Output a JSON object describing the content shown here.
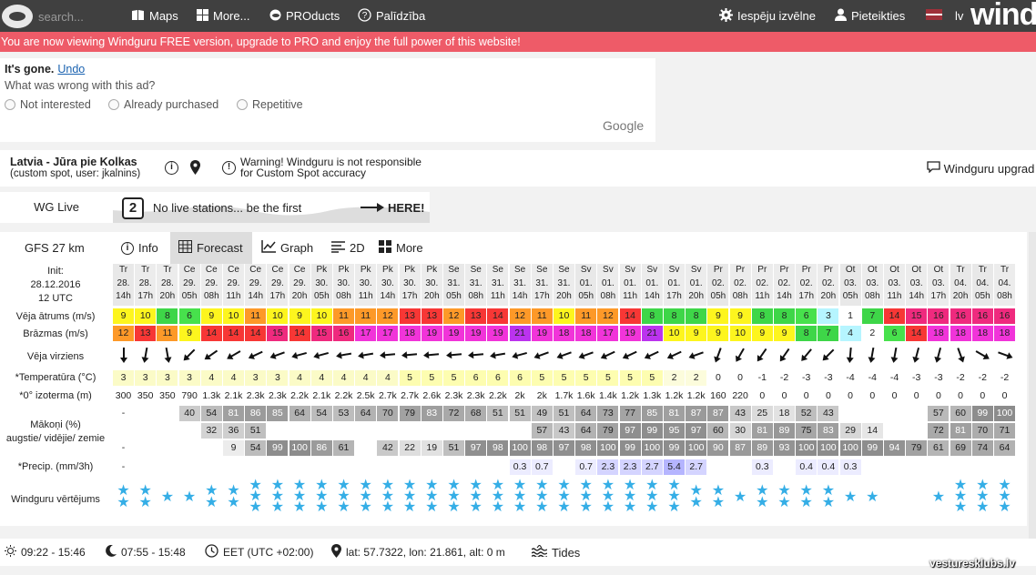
{
  "topbar": {
    "search_placeholder": "search...",
    "maps": "Maps",
    "more": "More...",
    "products": "PROducts",
    "help": "Palīdzība",
    "settings": "Iespēju izvēlne",
    "login": "Pieteikties",
    "lang": "lv",
    "brand": "wind"
  },
  "promo": "You are now viewing Windguru FREE version, upgrade to PRO and enjoy the full power of this website!",
  "ad": {
    "gone": "It's gone.",
    "undo": "Undo",
    "question": "What was wrong with this ad?",
    "opt1": "Not interested",
    "opt2": "Already purchased",
    "opt3": "Repetitive",
    "google": "Google"
  },
  "spot": {
    "name": "Latvia - Jūra pie Kolkas",
    "sub": "(custom spot, user: jkalnins)",
    "warning_line1": "Warning! Windguru is not responsible",
    "warning_line2": "for Custom Spot accuracy",
    "upgrade": "Windguru upgrad"
  },
  "live": {
    "title": "WG Live",
    "badge": "2",
    "text": "No live stations... be the first",
    "here": "HERE!"
  },
  "model": {
    "name": "GFS 27 km",
    "tabs": [
      "Info",
      "Forecast",
      "Graph",
      "2D",
      "More"
    ]
  },
  "labels": {
    "init": "Init:",
    "init_date": "28.12.2016",
    "init_time": "12 UTC",
    "wind": "Vēja ātrums (m/s)",
    "gust": "Brāzmas (m/s)",
    "dir": "Vēja virziens",
    "temp": "*Temperatūra (°C)",
    "iso": "*0° izoterma (m)",
    "cloud1": "Mākoņi (%)",
    "cloud2": "augstie/ vidējie/ zemie",
    "precip": "*Precip. (mm/3h)",
    "rating": "Windguru vērtējums"
  },
  "forecast": {
    "days": [
      "Tr",
      "Tr",
      "Tr",
      "Ce",
      "Ce",
      "Ce",
      "Ce",
      "Ce",
      "Ce",
      "Pk",
      "Pk",
      "Pk",
      "Pk",
      "Pk",
      "Pk",
      "Se",
      "Se",
      "Se",
      "Se",
      "Se",
      "Se",
      "Sv",
      "Sv",
      "Sv",
      "Sv",
      "Sv",
      "Sv",
      "Pr",
      "Pr",
      "Pr",
      "Pr",
      "Pr",
      "Pr",
      "Ot",
      "Ot",
      "Ot",
      "Ot",
      "Ot",
      "Tr",
      "Tr",
      "Tr"
    ],
    "dates": [
      "28.",
      "28.",
      "28.",
      "29.",
      "29.",
      "29.",
      "29.",
      "29.",
      "29.",
      "30.",
      "30.",
      "30.",
      "30.",
      "30.",
      "30.",
      "31.",
      "31.",
      "31.",
      "31.",
      "31.",
      "31.",
      "01.",
      "01.",
      "01.",
      "01.",
      "01.",
      "01.",
      "02.",
      "02.",
      "02.",
      "02.",
      "02.",
      "02.",
      "03.",
      "03.",
      "03.",
      "03.",
      "03.",
      "04.",
      "04.",
      "04."
    ],
    "hours": [
      "14h",
      "17h",
      "20h",
      "05h",
      "08h",
      "11h",
      "14h",
      "17h",
      "20h",
      "05h",
      "08h",
      "11h",
      "14h",
      "17h",
      "20h",
      "05h",
      "08h",
      "11h",
      "14h",
      "17h",
      "20h",
      "05h",
      "08h",
      "11h",
      "14h",
      "17h",
      "20h",
      "05h",
      "08h",
      "11h",
      "14h",
      "17h",
      "20h",
      "05h",
      "08h",
      "11h",
      "14h",
      "17h",
      "20h",
      "05h",
      "08h"
    ],
    "wind": [
      9,
      10,
      8,
      6,
      9,
      10,
      11,
      10,
      9,
      10,
      11,
      11,
      12,
      13,
      13,
      12,
      13,
      14,
      12,
      11,
      10,
      11,
      12,
      14,
      8,
      8,
      8,
      9,
      9,
      8,
      8,
      6,
      3,
      1,
      7,
      14,
      15,
      16,
      16,
      16,
      16
    ],
    "gust": [
      12,
      13,
      11,
      9,
      14,
      14,
      14,
      15,
      14,
      15,
      16,
      17,
      17,
      18,
      19,
      19,
      19,
      19,
      21,
      19,
      18,
      18,
      17,
      19,
      21,
      10,
      9,
      9,
      10,
      9,
      9,
      8,
      7,
      4,
      2,
      6,
      14,
      18,
      18,
      18,
      18
    ],
    "dir_deg": [
      180,
      190,
      170,
      225,
      235,
      240,
      245,
      250,
      255,
      255,
      260,
      260,
      265,
      265,
      265,
      265,
      265,
      260,
      255,
      250,
      250,
      250,
      245,
      245,
      245,
      245,
      250,
      200,
      210,
      215,
      215,
      220,
      225,
      185,
      190,
      190,
      195,
      195,
      160,
      120,
      110
    ],
    "temp": [
      "3",
      "3",
      "3",
      "3",
      "4",
      "4",
      "3",
      "3",
      "4",
      "4",
      "4",
      "4",
      "4",
      "5",
      "5",
      "5",
      "6",
      "6",
      "6",
      "5",
      "5",
      "5",
      "5",
      "5",
      "5",
      "2",
      "2",
      "0",
      "0",
      "-1",
      "-2",
      "-3",
      "-3",
      "-4",
      "-4",
      "-4",
      "-3",
      "-3",
      "-2",
      "-2",
      "-2"
    ],
    "iso": [
      "300",
      "350",
      "350",
      "790",
      "1.3k",
      "2.1k",
      "2.3k",
      "2.3k",
      "2.2k",
      "2.1k",
      "2.2k",
      "2.5k",
      "2.7k",
      "2.7k",
      "2.6k",
      "2.3k",
      "2.3k",
      "2.2k",
      "2k",
      "2k",
      "1.7k",
      "1.6k",
      "1.4k",
      "1.2k",
      "1.3k",
      "1.2k",
      "1.2k",
      "160",
      "220",
      "0",
      "0",
      "0",
      "0",
      "0",
      "0",
      "0",
      "0",
      "0",
      "0",
      "0",
      "0"
    ],
    "cloud_high": [
      "-",
      "",
      "",
      "40",
      "54",
      "81",
      "86",
      "85",
      "64",
      "54",
      "53",
      "64",
      "70",
      "79",
      "83",
      "72",
      "68",
      "51",
      "51",
      "49",
      "51",
      "64",
      "73",
      "77",
      "85",
      "81",
      "87",
      "87",
      "43",
      "25",
      "18",
      "52",
      "43",
      "",
      "",
      "",
      "",
      "57",
      "60",
      "99",
      "100"
    ],
    "cloud_mid": [
      "",
      "",
      "",
      "",
      "32",
      "36",
      "51",
      "",
      "",
      "",
      "",
      "",
      "",
      "",
      "",
      "",
      "",
      "",
      "",
      "57",
      "43",
      "64",
      "79",
      "97",
      "99",
      "95",
      "97",
      "60",
      "30",
      "81",
      "89",
      "75",
      "83",
      "29",
      "14",
      "",
      "",
      "72",
      "81",
      "70",
      "71"
    ],
    "cloud_low": [
      "-",
      "",
      "",
      "",
      "",
      "9",
      "54",
      "99",
      "100",
      "86",
      "61",
      "",
      "42",
      "22",
      "19",
      "51",
      "97",
      "98",
      "100",
      "98",
      "97",
      "98",
      "100",
      "99",
      "100",
      "99",
      "100",
      "90",
      "87",
      "89",
      "93",
      "100",
      "100",
      "100",
      "99",
      "94",
      "79",
      "61",
      "69",
      "74",
      "64"
    ],
    "precip": [
      "-",
      "",
      "",
      "",
      "",
      "",
      "",
      "",
      "",
      "",
      "",
      "",
      "",
      "",
      "",
      "",
      "",
      "",
      "0.3",
      "0.7",
      "",
      "0.7",
      "2.3",
      "2.3",
      "2.7",
      "5.4",
      "2.7",
      "",
      "",
      "0.3",
      "",
      "0.4",
      "0.4",
      "0.3",
      "",
      "",
      "",
      "",
      "",
      "",
      ""
    ],
    "stars": [
      2,
      2,
      1,
      1,
      2,
      2,
      3,
      3,
      3,
      3,
      3,
      3,
      3,
      3,
      3,
      3,
      3,
      3,
      3,
      3,
      3,
      3,
      3,
      3,
      3,
      3,
      2,
      2,
      1,
      2,
      2,
      2,
      2,
      1,
      1,
      0,
      0,
      1,
      3,
      3,
      3
    ]
  },
  "bottom": {
    "sun": "09:22 - 15:46",
    "moon": "07:55 - 15:48",
    "tz": "EET (UTC +02:00)",
    "loc": "lat: 57.7322, lon: 21.861, alt: 0 m",
    "tides": "Tides",
    "watermark": "vesturesklubs.lv"
  }
}
